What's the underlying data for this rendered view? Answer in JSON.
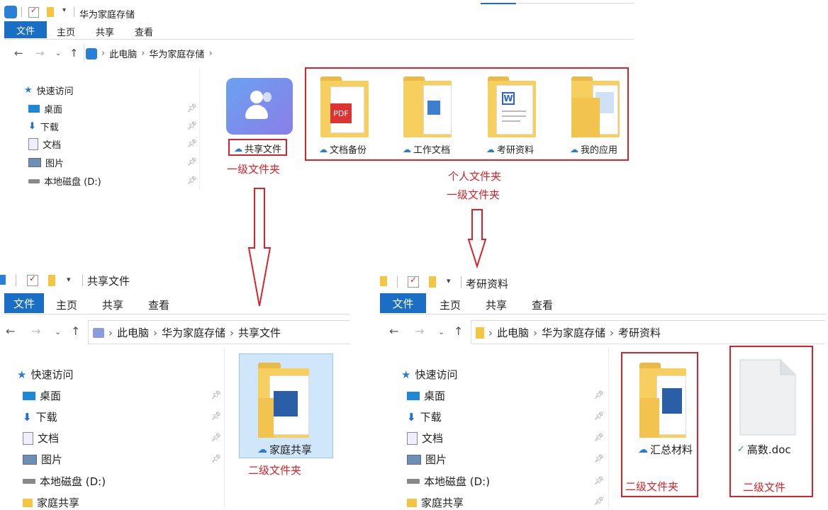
{
  "top": {
    "title": "华为家庭存储",
    "tabs": [
      "文件",
      "主页",
      "共享",
      "查看"
    ],
    "breadcrumb": [
      "此电脑",
      "华为家庭存储"
    ],
    "nav": {
      "quick_access": "快速访问",
      "items": [
        "桌面",
        "下载",
        "文档",
        "图片",
        "本地磁盘 (D:)"
      ]
    },
    "shared_folder": "共享文件",
    "personal_folders": [
      "文档备份",
      "工作文档",
      "考研资料",
      "我的应用"
    ],
    "labels": {
      "shared_level": "一级文件夹",
      "personal": "个人文件夹",
      "personal_level": "一级文件夹"
    }
  },
  "left": {
    "title": "共享文件",
    "tabs": [
      "文件",
      "主页",
      "共享",
      "查看"
    ],
    "breadcrumb": [
      "此电脑",
      "华为家庭存储",
      "共享文件"
    ],
    "nav": {
      "quick_access": "快速访问",
      "items": [
        "桌面",
        "下载",
        "文档",
        "图片",
        "本地磁盘 (D:)",
        "家庭共享"
      ]
    },
    "folder": "家庭共享",
    "label": "二级文件夹"
  },
  "right": {
    "title": "考研资料",
    "tabs": [
      "文件",
      "主页",
      "共享",
      "查看"
    ],
    "breadcrumb": [
      "此电脑",
      "华为家庭存储",
      "考研资料"
    ],
    "nav": {
      "quick_access": "快速访问",
      "items": [
        "桌面",
        "下载",
        "文档",
        "图片",
        "本地磁盘 (D:)",
        "家庭共享"
      ]
    },
    "folder": "汇总材料",
    "file": "高数.doc",
    "folder_label": "二级文件夹",
    "file_label": "二级文件"
  },
  "colors": {
    "accent": "#1a6fc4",
    "annotation": "#d8232a",
    "folder": "#f6cf5f"
  }
}
